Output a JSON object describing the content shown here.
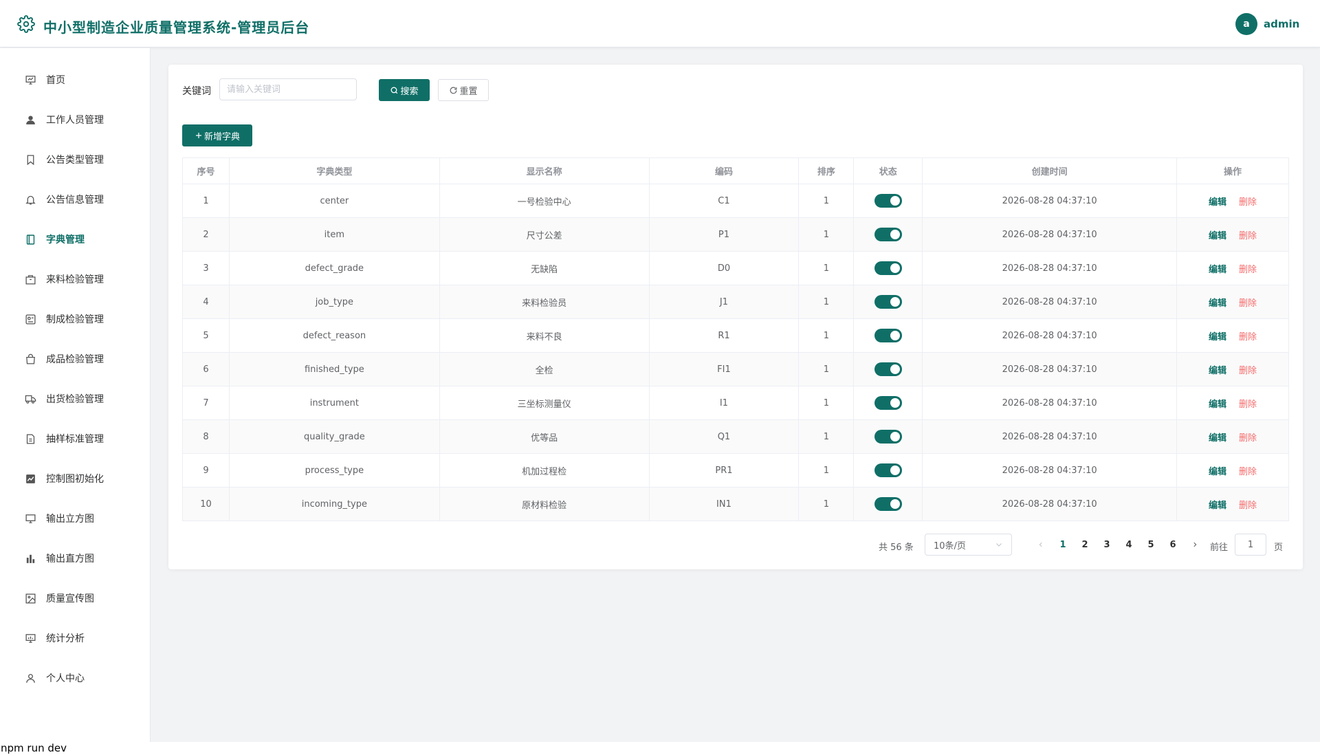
{
  "header": {
    "title": "中小型制造企业质量管理系统-管理员后台",
    "avatar_letter": "a",
    "username": "admin",
    "brand_color": "#0f6f67"
  },
  "sidebar": {
    "items": [
      {
        "label": "首页",
        "icon": "dashboard-icon"
      },
      {
        "label": "工作人员管理",
        "icon": "user-icon"
      },
      {
        "label": "公告类型管理",
        "icon": "bookmark-icon"
      },
      {
        "label": "公告信息管理",
        "icon": "bell-icon"
      },
      {
        "label": "字典管理",
        "icon": "book-icon",
        "active": true
      },
      {
        "label": "来料检验管理",
        "icon": "package-icon"
      },
      {
        "label": "制成检验管理",
        "icon": "process-icon"
      },
      {
        "label": "成品检验管理",
        "icon": "bag-icon"
      },
      {
        "label": "出货检验管理",
        "icon": "truck-icon"
      },
      {
        "label": "抽样标准管理",
        "icon": "document-icon"
      },
      {
        "label": "控制图初始化",
        "icon": "line-chart-icon"
      },
      {
        "label": "输出立方图",
        "icon": "chart-board-icon"
      },
      {
        "label": "输出直方图",
        "icon": "histogram-icon"
      },
      {
        "label": "质量宣传图",
        "icon": "picture-icon"
      },
      {
        "label": "统计分析",
        "icon": "stats-board-icon"
      },
      {
        "label": "个人中心",
        "icon": "person-icon"
      }
    ]
  },
  "search": {
    "label": "关键词",
    "placeholder": "请输入关键词",
    "search_button": "搜索",
    "reset_button": "重置",
    "add_button": "新增字典"
  },
  "table": {
    "headers": [
      "序号",
      "字典类型",
      "显示名称",
      "编码",
      "排序",
      "状态",
      "创建时间",
      "操作"
    ],
    "edit_label": "编辑",
    "delete_label": "删除",
    "rows": [
      {
        "no": "1",
        "type": "center",
        "name": "一号检验中心",
        "code": "C1",
        "sort": "1",
        "enabled": true,
        "created": "2026-08-28 04:37:10"
      },
      {
        "no": "2",
        "type": "item",
        "name": "尺寸公差",
        "code": "P1",
        "sort": "1",
        "enabled": true,
        "created": "2026-08-28 04:37:10"
      },
      {
        "no": "3",
        "type": "defect_grade",
        "name": "无缺陷",
        "code": "D0",
        "sort": "1",
        "enabled": true,
        "created": "2026-08-28 04:37:10"
      },
      {
        "no": "4",
        "type": "job_type",
        "name": "来料检验员",
        "code": "J1",
        "sort": "1",
        "enabled": true,
        "created": "2026-08-28 04:37:10"
      },
      {
        "no": "5",
        "type": "defect_reason",
        "name": "来料不良",
        "code": "R1",
        "sort": "1",
        "enabled": true,
        "created": "2026-08-28 04:37:10"
      },
      {
        "no": "6",
        "type": "finished_type",
        "name": "全检",
        "code": "FI1",
        "sort": "1",
        "enabled": true,
        "created": "2026-08-28 04:37:10"
      },
      {
        "no": "7",
        "type": "instrument",
        "name": "三坐标测量仪",
        "code": "I1",
        "sort": "1",
        "enabled": true,
        "created": "2026-08-28 04:37:10"
      },
      {
        "no": "8",
        "type": "quality_grade",
        "name": "优等品",
        "code": "Q1",
        "sort": "1",
        "enabled": true,
        "created": "2026-08-28 04:37:10"
      },
      {
        "no": "9",
        "type": "process_type",
        "name": "机加过程检",
        "code": "PR1",
        "sort": "1",
        "enabled": true,
        "created": "2026-08-28 04:37:10"
      },
      {
        "no": "10",
        "type": "incoming_type",
        "name": "原材料检验",
        "code": "IN1",
        "sort": "1",
        "enabled": true,
        "created": "2026-08-28 04:37:10"
      }
    ]
  },
  "pagination": {
    "total_text": "共 56 条",
    "page_size": "10条/页",
    "pages": [
      "1",
      "2",
      "3",
      "4",
      "5",
      "6"
    ],
    "current": "1",
    "goto_label": "前往",
    "goto_value": "1",
    "goto_unit": "页"
  },
  "footer": {
    "terminal_text": "npm run dev"
  }
}
